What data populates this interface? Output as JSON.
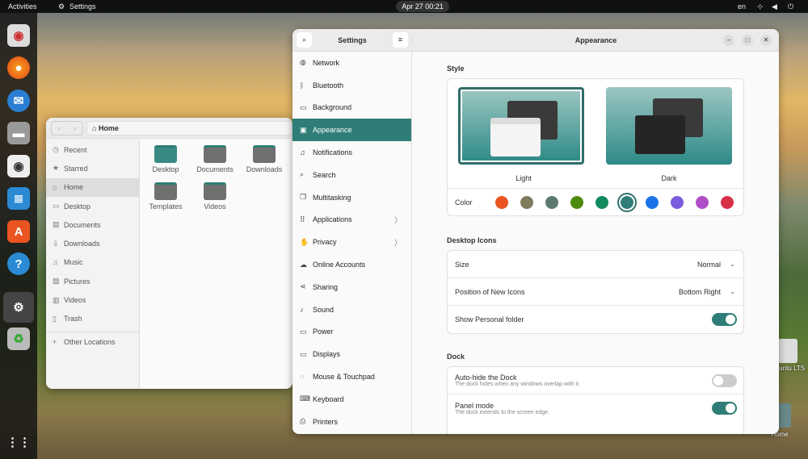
{
  "topbar": {
    "activities": "Activities",
    "app": "Settings",
    "clock": "Apr 27  00:21",
    "lang": "en"
  },
  "files": {
    "path": "Home",
    "sidebar": [
      "Recent",
      "Starred",
      "Home",
      "Desktop",
      "Documents",
      "Downloads",
      "Music",
      "Pictures",
      "Videos",
      "Trash",
      "Other Locations"
    ],
    "folders": [
      "Desktop",
      "Documents",
      "Downloads",
      "Templates",
      "Videos"
    ]
  },
  "settings": {
    "title": "Settings",
    "page_title": "Appearance",
    "sidebar": [
      "Network",
      "Bluetooth",
      "Background",
      "Appearance",
      "Notifications",
      "Search",
      "Multitasking",
      "Applications",
      "Privacy",
      "Online Accounts",
      "Sharing",
      "Sound",
      "Power",
      "Displays",
      "Mouse & Touchpad",
      "Keyboard",
      "Printers"
    ],
    "style": {
      "label": "Style",
      "light": "Light",
      "dark": "Dark",
      "color_label": "Color",
      "colors": [
        "#e95420",
        "#7f7a5c",
        "#5e7a6e",
        "#4e8a0e",
        "#108a5e",
        "#2f7d77",
        "#1a73e8",
        "#7a5ce0",
        "#b04ec8",
        "#d9304a"
      ]
    },
    "desktop_icons": {
      "label": "Desktop Icons",
      "size_label": "Size",
      "size_value": "Normal",
      "position_label": "Position of New Icons",
      "position_value": "Bottom Right",
      "personal_label": "Show Personal folder",
      "personal_on": true
    },
    "dock": {
      "label": "Dock",
      "autohide_label": "Auto-hide the Dock",
      "autohide_sub": "The dock hides when any windows overlap with it.",
      "autohide_on": false,
      "panel_label": "Panel mode",
      "panel_sub": "The dock extends to the screen edge.",
      "panel_on": true
    }
  },
  "desktop": {
    "ubuntu": "Ubuntu LTS",
    "home": "Home"
  }
}
